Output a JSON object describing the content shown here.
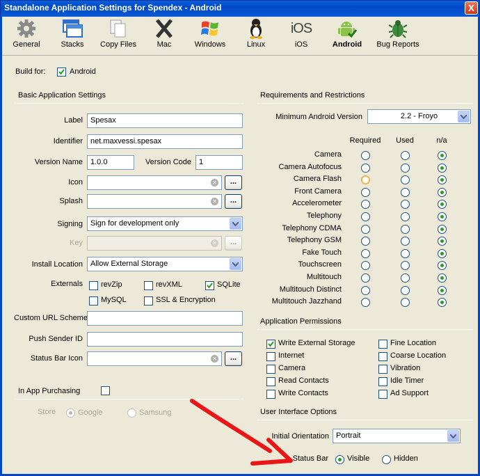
{
  "window": {
    "title": "Standalone Application Settings for Spendex - Android",
    "close": "X"
  },
  "toolbar": [
    {
      "label": "General",
      "icon": "gear-icon"
    },
    {
      "label": "Stacks",
      "icon": "stacks-icon"
    },
    {
      "label": "Copy Files",
      "icon": "copy-files-icon"
    },
    {
      "label": "Mac",
      "icon": "mac-icon"
    },
    {
      "label": "Windows",
      "icon": "windows-icon"
    },
    {
      "label": "Linux",
      "icon": "linux-icon"
    },
    {
      "label": "iOS",
      "icon": "ios-icon"
    },
    {
      "label": "Android",
      "icon": "android-icon",
      "selected": true
    },
    {
      "label": "Bug Reports",
      "icon": "bug-icon"
    }
  ],
  "build": {
    "label": "Build for:",
    "option": "Android",
    "checked": true
  },
  "basic": {
    "title": "Basic Application Settings",
    "label_l": "Label",
    "label_v": "Spesax",
    "ident_l": "Identifier",
    "ident_v": "net.maxvessi.spesax",
    "ver_l": "Version Name",
    "ver_v": "1.0.0",
    "code_l": "Version Code",
    "code_v": "1",
    "icon_l": "Icon",
    "splash_l": "Splash",
    "signing_l": "Signing",
    "signing_v": "Sign for development only",
    "key_l": "Key",
    "install_l": "Install Location",
    "install_v": "Allow External Storage",
    "externals_l": "Externals",
    "ext": [
      {
        "label": "revZip",
        "checked": false
      },
      {
        "label": "revXML",
        "checked": false
      },
      {
        "label": "SQLite",
        "checked": true
      },
      {
        "label": "MySQL",
        "checked": false
      },
      {
        "label": "SSL & Encryption",
        "checked": false
      }
    ],
    "url_l": "Custom URL Scheme",
    "push_l": "Push Sender ID",
    "statusicon_l": "Status Bar Icon",
    "browse": "..."
  },
  "iap": {
    "label": "In App Purchasing",
    "store_l": "Store",
    "google": "Google",
    "samsung": "Samsung"
  },
  "req": {
    "title": "Requirements and Restrictions",
    "minver_l": "Minimum Android Version",
    "minver_v": "2.2 - Froyo",
    "cols": [
      "Required",
      "Used",
      "n/a"
    ],
    "rows": [
      "Camera",
      "Camera Autofocus",
      "Camera Flash",
      "Front Camera",
      "Accelerometer",
      "Telephony",
      "Telephony CDMA",
      "Telephony GSM",
      "Fake Touch",
      "Touchscreen",
      "Multitouch",
      "Multitouch Distinct",
      "Multitouch Jazzhand"
    ]
  },
  "perm": {
    "title": "Application Permissions",
    "left": [
      {
        "label": "Write External Storage",
        "checked": true
      },
      {
        "label": "Internet",
        "checked": false
      },
      {
        "label": "Camera",
        "checked": false
      },
      {
        "label": "Read Contacts",
        "checked": false
      },
      {
        "label": "Write Contacts",
        "checked": false
      }
    ],
    "right": [
      {
        "label": "Fine Location",
        "checked": false
      },
      {
        "label": "Coarse Location",
        "checked": false
      },
      {
        "label": "Vibration",
        "checked": false
      },
      {
        "label": "Idle Timer",
        "checked": false
      },
      {
        "label": "Ad Support",
        "checked": false
      }
    ]
  },
  "ui": {
    "title": "User Interface Options",
    "orient_l": "Initial Orientation",
    "orient_v": "Portrait",
    "status_l": "Status Bar",
    "visible": "Visible",
    "hidden": "Hidden"
  }
}
